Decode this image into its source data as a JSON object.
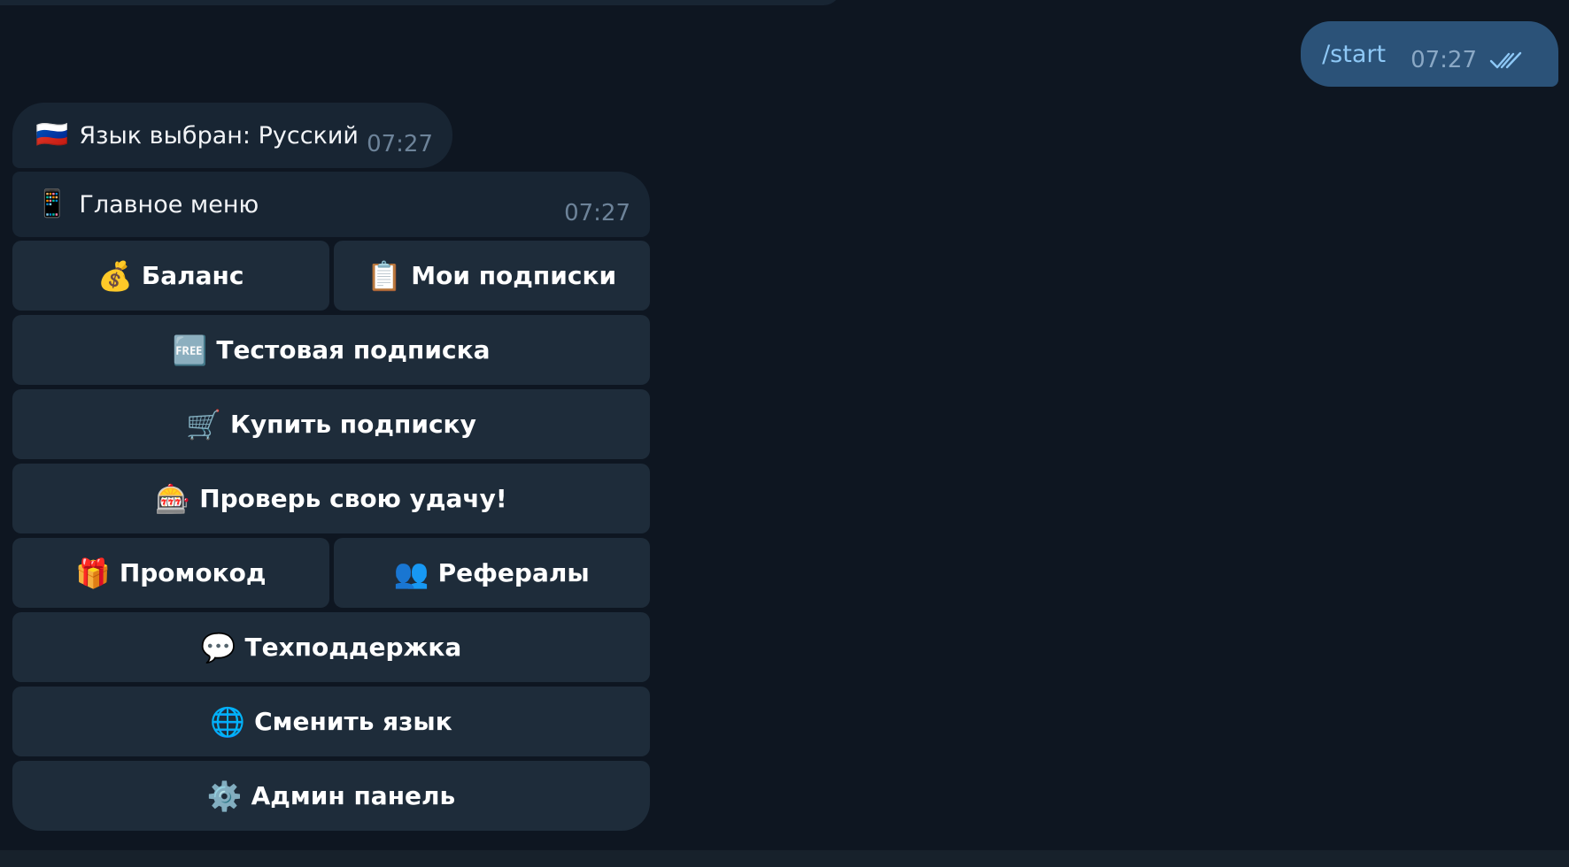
{
  "outgoing_message": {
    "text": "/start",
    "time": "07:27",
    "status_icon": "double-check-icon"
  },
  "incoming_messages": [
    {
      "emoji": "🇷🇺",
      "icon": "russia-flag-icon",
      "text": "Язык выбран: Русский",
      "time": "07:27"
    },
    {
      "emoji": "📱",
      "icon": "mobile-phone-icon",
      "text": "Главное меню",
      "time": "07:27"
    }
  ],
  "keyboard": {
    "balance": {
      "emoji": "💰",
      "icon": "money-bag-icon",
      "label": "Баланс"
    },
    "my_subscriptions": {
      "emoji": "📋",
      "icon": "clipboard-icon",
      "label": "Мои подписки"
    },
    "test_subscription": {
      "emoji": "🆓",
      "icon": "free-icon",
      "label": "Тестовая подписка"
    },
    "buy_subscription": {
      "emoji": "🛒",
      "icon": "shopping-cart-icon",
      "label": "Купить подписку"
    },
    "luck": {
      "emoji": "🎰",
      "icon": "slot-machine-icon",
      "label": "Проверь свою удачу!"
    },
    "promo": {
      "emoji": "🎁",
      "icon": "gift-icon",
      "label": "Промокод"
    },
    "referrals": {
      "emoji": "👥",
      "icon": "people-icon",
      "label": "Рефералы"
    },
    "support": {
      "emoji": "💬",
      "icon": "speech-bubble-icon",
      "label": "Техподдержка"
    },
    "change_language": {
      "emoji": "🌐",
      "icon": "globe-icon",
      "label": "Сменить язык"
    },
    "admin_panel": {
      "emoji": "⚙️",
      "icon": "gear-icon",
      "label": "Админ панель"
    }
  },
  "colors": {
    "background": "#0e1621",
    "incoming_bubble": "#182533",
    "outgoing_bubble": "#2b5278",
    "keyboard_button": "#1e2c3a",
    "outgoing_text": "#8ec8f6"
  }
}
